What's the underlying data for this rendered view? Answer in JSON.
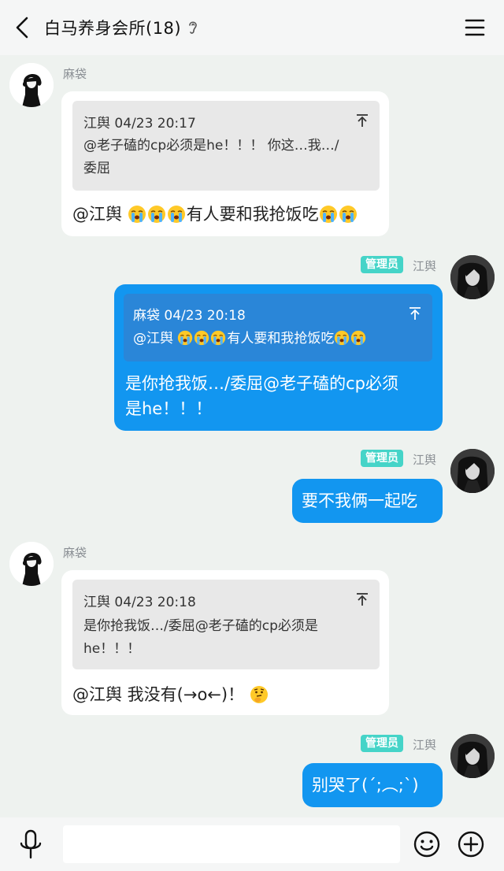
{
  "header": {
    "title": "白马养身会所(18)"
  },
  "messages": [
    {
      "sender": "麻袋",
      "side": "left",
      "quote": {
        "head": "江舆 04/23 20:17",
        "line1": "@老子磕的cp必须是he！！！ 你这…我…/",
        "line2": "委屈"
      },
      "text_prefix": "@江舆 ",
      "text_mid": "有人要和我抢饭吃"
    },
    {
      "sender": "江舆",
      "badge": "管理员",
      "side": "right",
      "quote": {
        "head": "麻袋 04/23 20:18",
        "line1_prefix": "@江舆 ",
        "line1_mid": "有人要和我抢饭吃"
      },
      "line1": "是你抢我饭…/委屈@老子磕的cp必须",
      "line2": "是he！！！"
    },
    {
      "sender": "江舆",
      "badge": "管理员",
      "side": "right",
      "text": "要不我俩一起吃"
    },
    {
      "sender": "麻袋",
      "side": "left",
      "quote": {
        "head": "江舆 04/23 20:18",
        "line1": "是你抢我饭…/委屈@老子磕的cp必须是",
        "line2": "he！！！"
      },
      "text": "@江舆 我没有(→o←)！"
    },
    {
      "sender": "江舆",
      "badge": "管理员",
      "side": "right",
      "text": "别哭了(´;︵;`)"
    }
  ],
  "input": {
    "placeholder": ""
  },
  "colors": {
    "accent_blue": "#1296f0",
    "admin_badge": "#45d4c8",
    "background": "#eef2ef"
  },
  "icons": [
    "back-icon",
    "ear-icon",
    "menu-icon",
    "up-arrow-icon",
    "crying-emoji",
    "thinking-emoji",
    "mic-icon",
    "smile-icon",
    "plus-icon"
  ]
}
